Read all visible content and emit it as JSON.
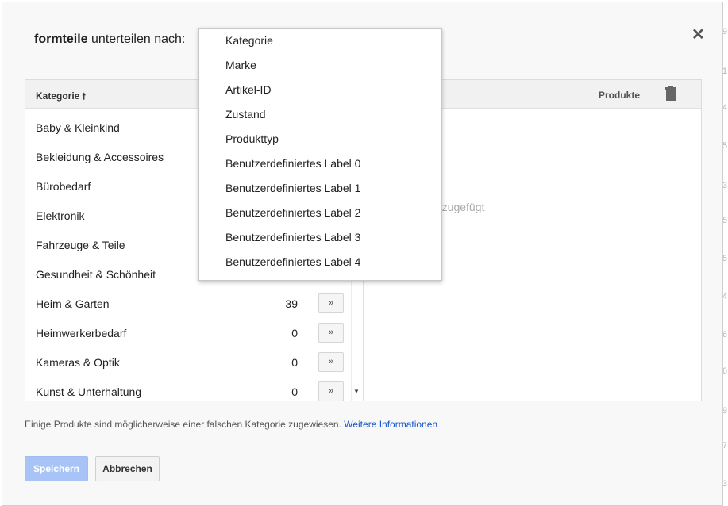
{
  "dialog": {
    "title_bold": "formteile",
    "title_rest": " unterteilen nach:",
    "close_label": "✕"
  },
  "table": {
    "col_kategorie": "Kategorie",
    "sort_arrow": "🠕",
    "col_produkte": "Produkte",
    "empty_right": "hinzugefügt",
    "rows": [
      {
        "name": "Baby & Kleinkind",
        "count": "",
        "btn": "»"
      },
      {
        "name": "Bekleidung & Accessoires",
        "count": "",
        "btn": "»"
      },
      {
        "name": "Bürobedarf",
        "count": "",
        "btn": "»"
      },
      {
        "name": "Elektronik",
        "count": "",
        "btn": "»"
      },
      {
        "name": "Fahrzeuge & Teile",
        "count": "",
        "btn": "»"
      },
      {
        "name": "Gesundheit & Schönheit",
        "count": "",
        "btn": "»"
      },
      {
        "name": "Heim & Garten",
        "count": "39",
        "btn": "»"
      },
      {
        "name": "Heimwerkerbedarf",
        "count": "0",
        "btn": "»"
      },
      {
        "name": "Kameras & Optik",
        "count": "0",
        "btn": "»"
      },
      {
        "name": "Kunst & Unterhaltung",
        "count": "0",
        "btn": "»"
      }
    ]
  },
  "dropdown": {
    "options": [
      "Kategorie",
      "Marke",
      "Artikel-ID",
      "Zustand",
      "Produkttyp",
      "Benutzerdefiniertes Label 0",
      "Benutzerdefiniertes Label 1",
      "Benutzerdefiniertes Label 2",
      "Benutzerdefiniertes Label 3",
      "Benutzerdefiniertes Label 4"
    ]
  },
  "footer": {
    "note": "Einige Produkte sind möglicherweise einer falschen Kategorie zugewiesen. ",
    "link": "Weitere Informationen",
    "save": "Speichern",
    "cancel": "Abbrechen"
  },
  "background_numbers": [
    "9",
    "1",
    "4",
    "5",
    "3",
    "5",
    "5",
    "4",
    "6",
    "6",
    "9",
    "7",
    "3",
    "1",
    "8"
  ],
  "colors": {
    "link": "#1155cc",
    "save_button": "#a8c4f7"
  }
}
